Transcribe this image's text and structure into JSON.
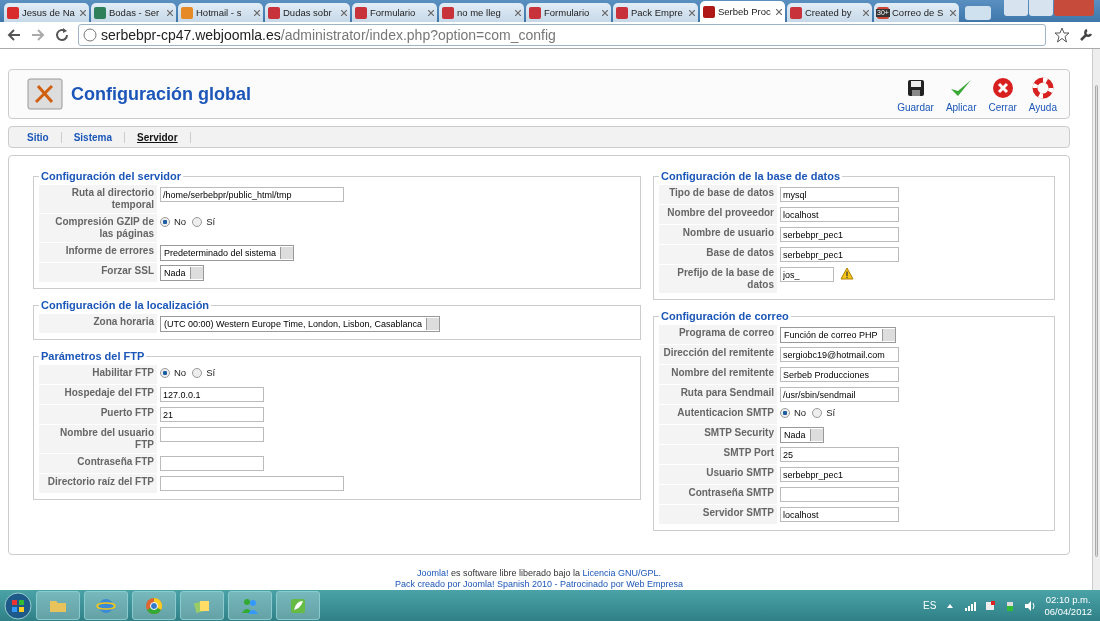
{
  "browser": {
    "tabs": [
      {
        "title": "Jesus de Na",
        "color": "#d92b2b",
        "selected": false
      },
      {
        "title": "Bodas - Ser",
        "color": "#2f7f5a",
        "selected": false
      },
      {
        "title": "Hotmail - s",
        "color": "#e58a25",
        "selected": false
      },
      {
        "title": "Dudas sobr",
        "color": "#c8323a",
        "selected": false
      },
      {
        "title": "Formulario",
        "color": "#c8323a",
        "selected": false
      },
      {
        "title": "no me lleg",
        "color": "#c8323a",
        "selected": false
      },
      {
        "title": "Formulario",
        "color": "#c8323a",
        "selected": false
      },
      {
        "title": "Pack Empre",
        "color": "#c8323a",
        "selected": false
      },
      {
        "title": "Serbeb Proc",
        "color": "#b01818",
        "selected": true
      },
      {
        "title": "Created by",
        "color": "#c8323a",
        "selected": false
      },
      {
        "title": "Correo de S",
        "color": "#d04437",
        "badge": "30+",
        "selected": false
      }
    ],
    "address": {
      "host": "serbebpr-cp47.webjoomla.es",
      "path": "/administrator/index.php?option=com_config"
    }
  },
  "header": {
    "title": "Configuración global",
    "actions": [
      {
        "label": "Guardar",
        "kind": "save"
      },
      {
        "label": "Aplicar",
        "kind": "apply"
      },
      {
        "label": "Cerrar",
        "kind": "close"
      },
      {
        "label": "Ayuda",
        "kind": "help"
      }
    ]
  },
  "tabs": [
    {
      "label": "Sitio",
      "selected": false
    },
    {
      "label": "Sistema",
      "selected": false
    },
    {
      "label": "Servidor",
      "selected": true
    }
  ],
  "left_column": [
    {
      "title": "Configuración del servidor",
      "rows": [
        {
          "label": "Ruta al directorio temporal",
          "kind": "text",
          "value": "/home/serbebpr/public_html/tmp",
          "wide": true
        },
        {
          "label": "Compresión GZIP de las páginas",
          "kind": "radio",
          "options": [
            {
              "label": "No",
              "selected": true
            },
            {
              "label": "Sí",
              "selected": false
            }
          ]
        },
        {
          "label": "Informe de errores",
          "kind": "select",
          "value": "Predeterminado del sistema"
        },
        {
          "label": "Forzar SSL",
          "kind": "select",
          "value": "Nada"
        }
      ]
    },
    {
      "title": "Configuración de la localización",
      "rows": [
        {
          "label": "Zona horaria",
          "kind": "select",
          "value": "(UTC 00:00) Western Europe Time, London, Lisbon, Casablanca"
        }
      ]
    },
    {
      "title": "Parámetros del FTP",
      "rows": [
        {
          "label": "Habilitar FTP",
          "kind": "radio",
          "options": [
            {
              "label": "No",
              "selected": true
            },
            {
              "label": "Sí",
              "selected": false
            }
          ]
        },
        {
          "label": "Hospedaje del FTP",
          "kind": "text",
          "value": "127.0.0.1",
          "wide": false
        },
        {
          "label": "Puerto FTP",
          "kind": "text",
          "value": "21",
          "wide": false
        },
        {
          "label": "Nombre del usuario FTP",
          "kind": "text",
          "value": "",
          "wide": false
        },
        {
          "label": "Contraseña FTP",
          "kind": "text",
          "value": "",
          "wide": false
        },
        {
          "label": "Directorio raíz del FTP",
          "kind": "text",
          "value": "",
          "wide": true
        }
      ]
    }
  ],
  "right_column": [
    {
      "title": "Configuración de la base de datos",
      "rows": [
        {
          "label": "Tipo de base de datos",
          "kind": "text",
          "value": "mysql",
          "wide": true
        },
        {
          "label": "Nombre del proveedor",
          "kind": "text",
          "value": "localhost",
          "wide": true
        },
        {
          "label": "Nombre de usuario",
          "kind": "text",
          "value": "serbebpr_pec1",
          "wide": true
        },
        {
          "label": "Base de datos",
          "kind": "text",
          "value": "serbebpr_pec1",
          "wide": true
        },
        {
          "label": "Prefijo de la base de datos",
          "kind": "warning",
          "value": "jos_",
          "wide": false
        }
      ]
    },
    {
      "title": "Configuración de correo",
      "rows": [
        {
          "label": "Programa de correo",
          "kind": "select",
          "value": "Función de correo PHP"
        },
        {
          "label": "Dirección del remitente",
          "kind": "text",
          "value": "sergiobc19@hotmail.com",
          "wide": true
        },
        {
          "label": "Nombre del remitente",
          "kind": "text",
          "value": "Serbeb Producciones",
          "wide": true
        },
        {
          "label": "Ruta para Sendmail",
          "kind": "text",
          "value": "/usr/sbin/sendmail",
          "wide": true
        },
        {
          "label": "Autenticacion SMTP",
          "kind": "radio",
          "options": [
            {
              "label": "No",
              "selected": true
            },
            {
              "label": "Sí",
              "selected": false
            }
          ]
        },
        {
          "label": "SMTP Security",
          "kind": "select",
          "value": "Nada"
        },
        {
          "label": "SMTP Port",
          "kind": "text",
          "value": "25",
          "wide": true
        },
        {
          "label": "Usuario SMTP",
          "kind": "text",
          "value": "serbebpr_pec1",
          "wide": true
        },
        {
          "label": "Contraseña SMTP",
          "kind": "text",
          "value": "",
          "wide": true
        },
        {
          "label": "Servidor SMTP",
          "kind": "text",
          "value": "localhost",
          "wide": true
        }
      ]
    }
  ],
  "footer": [
    [
      {
        "text": "Joomla!",
        "link": true
      },
      {
        "text": " es software libre liberado bajo la ",
        "link": false
      },
      {
        "text": "Licencia GNU/GPL.",
        "link": true
      }
    ],
    [
      {
        "text": "Pack creado por Joomla! Spanish 2010 - Patrocinado por Web Empresa",
        "link": true
      }
    ]
  ],
  "tray": {
    "language": "ES",
    "time": "02:10 p.m.",
    "date": "06/04/2012"
  }
}
